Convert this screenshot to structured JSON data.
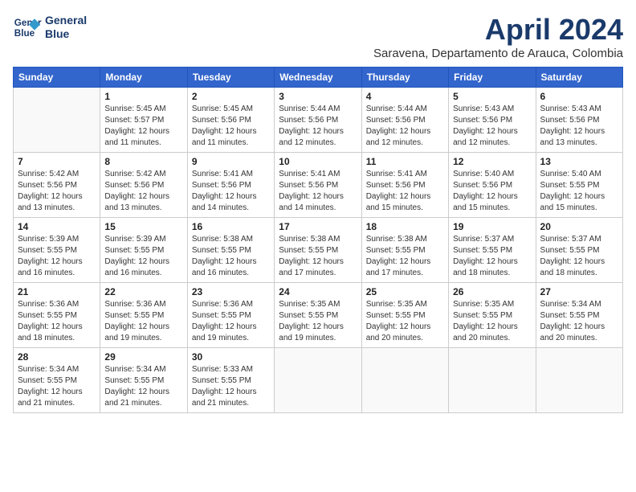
{
  "header": {
    "logo_line1": "General",
    "logo_line2": "Blue",
    "month_title": "April 2024",
    "subtitle": "Saravena, Departamento de Arauca, Colombia"
  },
  "weekdays": [
    "Sunday",
    "Monday",
    "Tuesday",
    "Wednesday",
    "Thursday",
    "Friday",
    "Saturday"
  ],
  "weeks": [
    [
      {
        "day": "",
        "info": ""
      },
      {
        "day": "1",
        "info": "Sunrise: 5:45 AM\nSunset: 5:57 PM\nDaylight: 12 hours\nand 11 minutes."
      },
      {
        "day": "2",
        "info": "Sunrise: 5:45 AM\nSunset: 5:56 PM\nDaylight: 12 hours\nand 11 minutes."
      },
      {
        "day": "3",
        "info": "Sunrise: 5:44 AM\nSunset: 5:56 PM\nDaylight: 12 hours\nand 12 minutes."
      },
      {
        "day": "4",
        "info": "Sunrise: 5:44 AM\nSunset: 5:56 PM\nDaylight: 12 hours\nand 12 minutes."
      },
      {
        "day": "5",
        "info": "Sunrise: 5:43 AM\nSunset: 5:56 PM\nDaylight: 12 hours\nand 12 minutes."
      },
      {
        "day": "6",
        "info": "Sunrise: 5:43 AM\nSunset: 5:56 PM\nDaylight: 12 hours\nand 13 minutes."
      }
    ],
    [
      {
        "day": "7",
        "info": "Sunrise: 5:42 AM\nSunset: 5:56 PM\nDaylight: 12 hours\nand 13 minutes."
      },
      {
        "day": "8",
        "info": "Sunrise: 5:42 AM\nSunset: 5:56 PM\nDaylight: 12 hours\nand 13 minutes."
      },
      {
        "day": "9",
        "info": "Sunrise: 5:41 AM\nSunset: 5:56 PM\nDaylight: 12 hours\nand 14 minutes."
      },
      {
        "day": "10",
        "info": "Sunrise: 5:41 AM\nSunset: 5:56 PM\nDaylight: 12 hours\nand 14 minutes."
      },
      {
        "day": "11",
        "info": "Sunrise: 5:41 AM\nSunset: 5:56 PM\nDaylight: 12 hours\nand 15 minutes."
      },
      {
        "day": "12",
        "info": "Sunrise: 5:40 AM\nSunset: 5:56 PM\nDaylight: 12 hours\nand 15 minutes."
      },
      {
        "day": "13",
        "info": "Sunrise: 5:40 AM\nSunset: 5:55 PM\nDaylight: 12 hours\nand 15 minutes."
      }
    ],
    [
      {
        "day": "14",
        "info": "Sunrise: 5:39 AM\nSunset: 5:55 PM\nDaylight: 12 hours\nand 16 minutes."
      },
      {
        "day": "15",
        "info": "Sunrise: 5:39 AM\nSunset: 5:55 PM\nDaylight: 12 hours\nand 16 minutes."
      },
      {
        "day": "16",
        "info": "Sunrise: 5:38 AM\nSunset: 5:55 PM\nDaylight: 12 hours\nand 16 minutes."
      },
      {
        "day": "17",
        "info": "Sunrise: 5:38 AM\nSunset: 5:55 PM\nDaylight: 12 hours\nand 17 minutes."
      },
      {
        "day": "18",
        "info": "Sunrise: 5:38 AM\nSunset: 5:55 PM\nDaylight: 12 hours\nand 17 minutes."
      },
      {
        "day": "19",
        "info": "Sunrise: 5:37 AM\nSunset: 5:55 PM\nDaylight: 12 hours\nand 18 minutes."
      },
      {
        "day": "20",
        "info": "Sunrise: 5:37 AM\nSunset: 5:55 PM\nDaylight: 12 hours\nand 18 minutes."
      }
    ],
    [
      {
        "day": "21",
        "info": "Sunrise: 5:36 AM\nSunset: 5:55 PM\nDaylight: 12 hours\nand 18 minutes."
      },
      {
        "day": "22",
        "info": "Sunrise: 5:36 AM\nSunset: 5:55 PM\nDaylight: 12 hours\nand 19 minutes."
      },
      {
        "day": "23",
        "info": "Sunrise: 5:36 AM\nSunset: 5:55 PM\nDaylight: 12 hours\nand 19 minutes."
      },
      {
        "day": "24",
        "info": "Sunrise: 5:35 AM\nSunset: 5:55 PM\nDaylight: 12 hours\nand 19 minutes."
      },
      {
        "day": "25",
        "info": "Sunrise: 5:35 AM\nSunset: 5:55 PM\nDaylight: 12 hours\nand 20 minutes."
      },
      {
        "day": "26",
        "info": "Sunrise: 5:35 AM\nSunset: 5:55 PM\nDaylight: 12 hours\nand 20 minutes."
      },
      {
        "day": "27",
        "info": "Sunrise: 5:34 AM\nSunset: 5:55 PM\nDaylight: 12 hours\nand 20 minutes."
      }
    ],
    [
      {
        "day": "28",
        "info": "Sunrise: 5:34 AM\nSunset: 5:55 PM\nDaylight: 12 hours\nand 21 minutes."
      },
      {
        "day": "29",
        "info": "Sunrise: 5:34 AM\nSunset: 5:55 PM\nDaylight: 12 hours\nand 21 minutes."
      },
      {
        "day": "30",
        "info": "Sunrise: 5:33 AM\nSunset: 5:55 PM\nDaylight: 12 hours\nand 21 minutes."
      },
      {
        "day": "",
        "info": ""
      },
      {
        "day": "",
        "info": ""
      },
      {
        "day": "",
        "info": ""
      },
      {
        "day": "",
        "info": ""
      }
    ]
  ]
}
